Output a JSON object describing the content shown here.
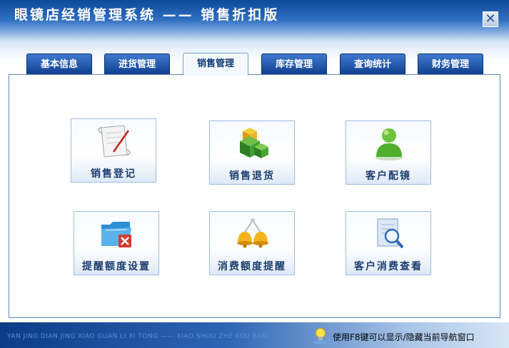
{
  "window": {
    "title": "眼镜店经销管理系统 —— 销售折扣版",
    "close_glyph": "✕"
  },
  "tabs": [
    {
      "label": "基本信息",
      "active": false
    },
    {
      "label": "进货管理",
      "active": false
    },
    {
      "label": "销售管理",
      "active": true
    },
    {
      "label": "库存管理",
      "active": false
    },
    {
      "label": "查询统计",
      "active": false
    },
    {
      "label": "财务管理",
      "active": false
    }
  ],
  "buttons": [
    {
      "label": "销售登记",
      "icon": "scroll-icon"
    },
    {
      "label": "销售退货",
      "icon": "cubes-icon"
    },
    {
      "label": "客户配镜",
      "icon": "user-icon"
    },
    {
      "label": "提醒额度设置",
      "icon": "folder-tools-icon"
    },
    {
      "label": "消费额度提醒",
      "icon": "bells-icon"
    },
    {
      "label": "客户消费查看",
      "icon": "document-search-icon"
    }
  ],
  "footer": {
    "pinyin": "YAN JING DIAN JING XIAO GUAN LI XI TONG —— XIAO SHOU ZHE KOU BAN",
    "hint": "使用F8键可以显示/隐藏当前导航窗口",
    "hint_icon": "lightbulb-icon"
  },
  "colors": {
    "title_bar": "#0d4a9a",
    "tab": "#1a4f9e",
    "tab_active": "#f3f8fd",
    "panel_border": "#5d86bf",
    "button_label": "#1d3d6e"
  }
}
